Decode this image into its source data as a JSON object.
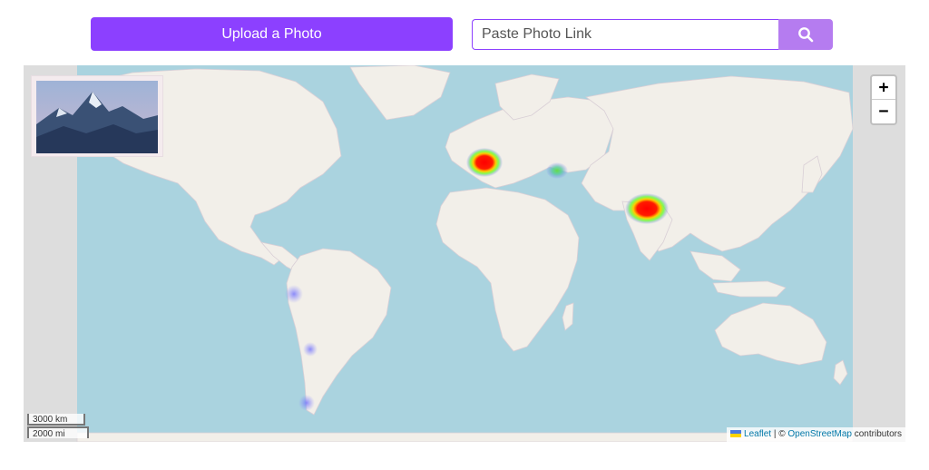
{
  "toolbar": {
    "upload_label": "Upload a Photo",
    "url_placeholder": "Paste Photo Link",
    "search_icon": "search-icon"
  },
  "map": {
    "zoom_in_label": "+",
    "zoom_out_label": "−",
    "scale_km": "3000 km",
    "scale_mi": "2000 mi",
    "attribution": {
      "leaflet_link": "Leaflet",
      "separator": "| ©",
      "osm_link": "OpenStreetMap",
      "suffix": "contributors"
    },
    "thumbnail_icon": "mountain-photo-thumbnail",
    "heatmap_hotspots": [
      "Western Europe (France/Switzerland)",
      "Caucasus",
      "Himalaya (Nepal/India)",
      "Andes (Peru)",
      "Andes (Chile/Argentina)",
      "Patagonia"
    ]
  },
  "colors": {
    "accent": "#8c40ff",
    "search_button": "#b57cf0",
    "ocean": "#aad3df",
    "land": "#f2efe9"
  }
}
